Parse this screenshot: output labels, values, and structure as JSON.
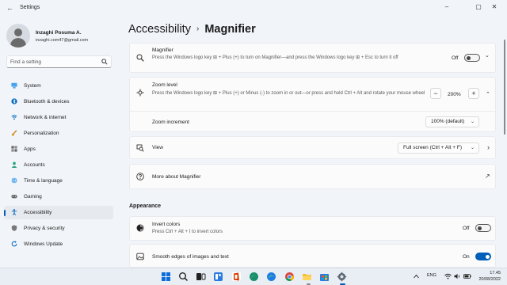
{
  "window": {
    "title": "Settings",
    "back_glyph": "←",
    "minimize_glyph": "–",
    "maximize_glyph": "▢",
    "close_glyph": "✕"
  },
  "user": {
    "name": "Inzaghi Posuma A.",
    "email": "inzaghi.com47@gmail.com"
  },
  "search": {
    "placeholder": "Find a setting"
  },
  "sidebar": {
    "items": [
      {
        "label": "System",
        "icon": "monitor-icon",
        "color": "#0067c0"
      },
      {
        "label": "Bluetooth & devices",
        "icon": "bluetooth-icon",
        "color": "#0067c0"
      },
      {
        "label": "Network & internet",
        "icon": "wifi-icon",
        "color": "#0067c0"
      },
      {
        "label": "Personalization",
        "icon": "brush-icon",
        "color": "#c7741b"
      },
      {
        "label": "Apps",
        "icon": "apps-icon",
        "color": "#555555"
      },
      {
        "label": "Accounts",
        "icon": "person-icon",
        "color": "#2aa37d"
      },
      {
        "label": "Time & language",
        "icon": "globe-icon",
        "color": "#0067c0"
      },
      {
        "label": "Gaming",
        "icon": "gamepad-icon",
        "color": "#555555"
      },
      {
        "label": "Accessibility",
        "icon": "accessibility-icon",
        "color": "#0067c0",
        "active": true
      },
      {
        "label": "Privacy & security",
        "icon": "shield-icon",
        "color": "#666666"
      },
      {
        "label": "Windows Update",
        "icon": "update-icon",
        "color": "#0067c0"
      }
    ]
  },
  "breadcrumb": {
    "parent": "Accessibility",
    "separator": "›",
    "current": "Magnifier"
  },
  "magnifier": {
    "title": "Magnifier",
    "description": "Press the Windows logo key ⊞ + Plus (+) to turn on Magnifier—and press the Windows logo key ⊞ + Esc to turn it off",
    "state_label": "Off",
    "expand_glyph": "⌄"
  },
  "zoom": {
    "title": "Zoom level",
    "description": "Press the Windows logo key ⊞ + Plus (+) or Minus (-) to zoom in or out—or press and hold Ctrl + Alt and rotate your mouse wheel",
    "minus": "−",
    "value": "200%",
    "plus": "+",
    "collapse_glyph": "⌃"
  },
  "zoom_increment": {
    "title": "Zoom increment",
    "value": "100% (default)",
    "dropdown_glyph": "⌄"
  },
  "view": {
    "title": "View",
    "value": "Full screen (Ctrl + Alt + F)",
    "chevron": "›"
  },
  "more": {
    "title": "More about Magnifier",
    "external_glyph": "↗"
  },
  "appearance": {
    "section_title": "Appearance",
    "invert": {
      "title": "Invert colors",
      "description": "Press Ctrl + Alt + I to invert colors",
      "state_label": "Off"
    },
    "smooth": {
      "title": "Smooth edges of images and text",
      "state_label": "On"
    }
  },
  "taskbar": {
    "icons": [
      "windows-start-icon",
      "search-icon",
      "task-view-icon",
      "widgets-icon",
      "office-icon",
      "edge-dev-icon",
      "edge-icon",
      "chrome-icon",
      "file-explorer-icon",
      "store-icon",
      "photos-icon",
      "settings-icon"
    ],
    "language": "ENG",
    "time": "17.45",
    "date": "20/08/2022"
  },
  "colors": {
    "accent": "#005fb8",
    "background": "#f1f4f9",
    "card": "#fbfbfc"
  }
}
